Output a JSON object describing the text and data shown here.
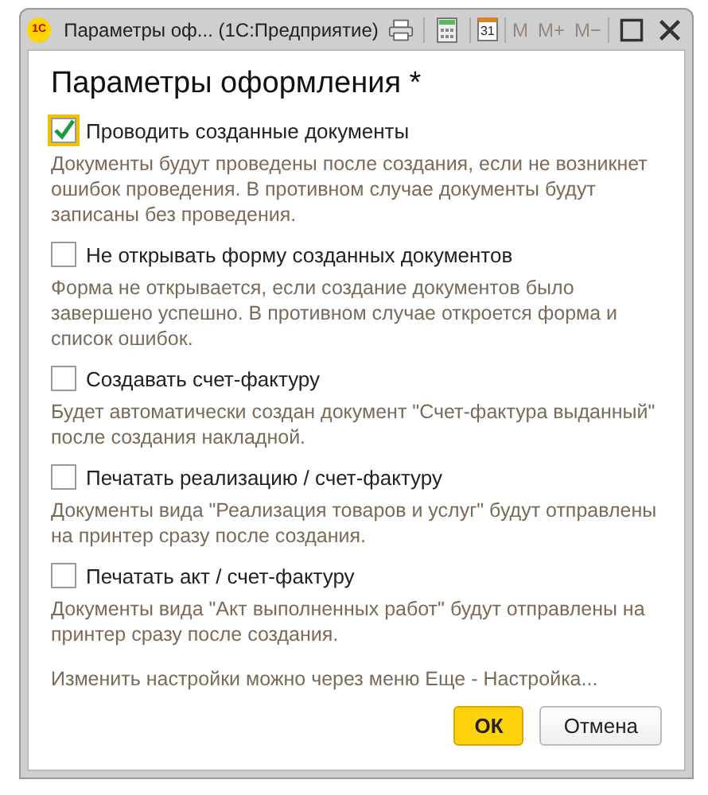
{
  "window": {
    "title": "Параметры оф...  (1С:Предприятие)",
    "logo": "1С",
    "calendar_day": "31",
    "memory_buttons": [
      {
        "label": "M",
        "disabled": true
      },
      {
        "label": "M+",
        "disabled": true
      },
      {
        "label": "M−",
        "disabled": true
      }
    ]
  },
  "heading": "Параметры оформления *",
  "options": [
    {
      "label": "Проводить созданные документы",
      "checked": true,
      "focused": true,
      "description": "Документы будут проведены после создания, если не возникнет ошибок проведения. В противном случае документы будут записаны без проведения."
    },
    {
      "label": "Не открывать форму созданных документов",
      "checked": false,
      "focused": false,
      "description": "Форма не открывается, если создание документов было завершено успешно. В противном случае откроется форма и список ошибок."
    },
    {
      "label": "Создавать счет-фактуру",
      "checked": false,
      "focused": false,
      "description": "Будет автоматически создан документ \"Счет-фактура выданный\" после создания накладной."
    },
    {
      "label": "Печатать реализацию / счет-фактуру",
      "checked": false,
      "focused": false,
      "description": "Документы вида \"Реализация товаров и услуг\" будут отправлены на принтер сразу после создания."
    },
    {
      "label": "Печатать акт / счет-фактуру",
      "checked": false,
      "focused": false,
      "description": "Документы вида \"Акт выполненных работ\" будут отправлены на принтер сразу после создания."
    }
  ],
  "hint": "Изменить настройки можно через меню Еще - Настройка...",
  "buttons": [
    {
      "label": "ОК",
      "kind": "primary"
    },
    {
      "label": "Отмена",
      "kind": "secondary"
    }
  ]
}
